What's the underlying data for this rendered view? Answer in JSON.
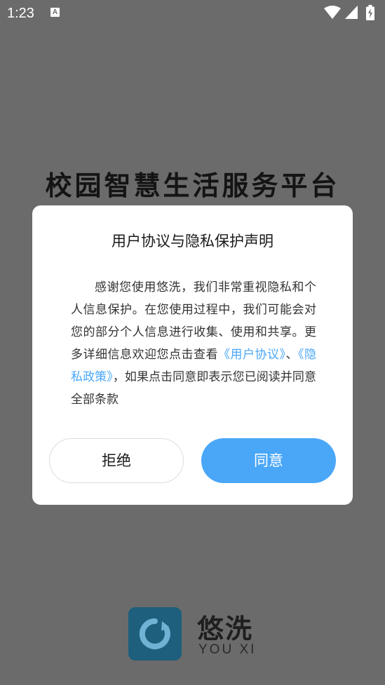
{
  "status_bar": {
    "time": "1:23",
    "notification_glyph": "A",
    "icons": [
      "wifi-icon",
      "signal-icon",
      "battery-icon"
    ]
  },
  "headline": "校园智慧生活服务平台",
  "dialog": {
    "title": "用户协议与隐私保护声明",
    "body_text_1": "感谢您使用悠洗，我们非常重视隐私和个人信息保护。在您使用过程中，我们可能会对您的部分个人信息进行收集、使用和共享。更多详细信息欢迎您点击查看",
    "user_agreement_link": "《用户协议》",
    "separator": "、",
    "privacy_policy_link": "《隐私政策》",
    "body_text_2": "，如果点击同意即表示您已阅读并同意全部条款",
    "reject_label": "拒绝",
    "agree_label": "同意"
  },
  "brand": {
    "name": "悠洗",
    "subtitle": "YOU XI"
  },
  "colors": {
    "accent": "#4aa7f8",
    "overlay": "#6b6b6b",
    "logo": "#1d5f7d"
  }
}
